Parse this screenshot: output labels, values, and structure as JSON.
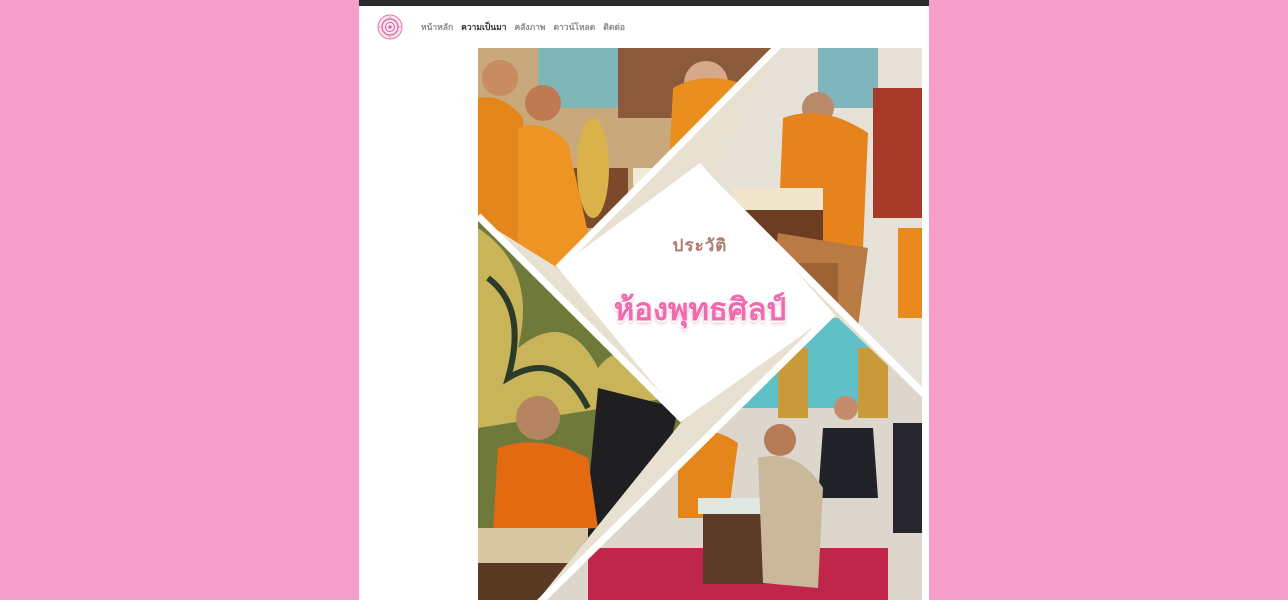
{
  "nav": {
    "items": [
      {
        "label": "หน้าหลัก",
        "active": false
      },
      {
        "label": "ความเป็นมา",
        "active": true
      },
      {
        "label": "คลังภาพ",
        "active": false
      },
      {
        "label": "ดาวน์โหลด",
        "active": false
      },
      {
        "label": "ติดต่อ",
        "active": false
      }
    ]
  },
  "hero": {
    "subtitle": "ประวัติ",
    "title": "ห้องพุทธศิลป์"
  },
  "colors": {
    "background": "#f59fca",
    "title_pink": "#f06aae",
    "subtitle_brown": "#b07a6e",
    "robe_orange": "#e98a1f"
  }
}
